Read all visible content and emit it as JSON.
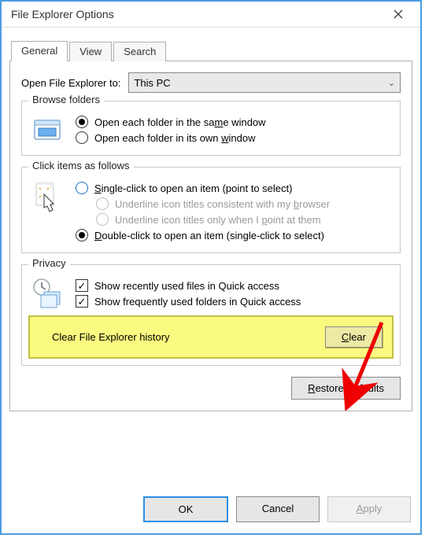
{
  "window": {
    "title": "File Explorer Options"
  },
  "tabs": {
    "general": "General",
    "view": "View",
    "search": "Search"
  },
  "open_to": {
    "label": "Open File Explorer to:",
    "value": "This PC"
  },
  "browse": {
    "legend": "Browse folders",
    "same_pre": "Open each folder in the sa",
    "same_u": "m",
    "same_post": "e window",
    "own_pre": "Open each folder in its own ",
    "own_u": "w",
    "own_post": "indow"
  },
  "click": {
    "legend": "Click items as follows",
    "single_u": "S",
    "single_post": "ingle-click to open an item (point to select)",
    "consistent_pre": "Underline icon titles consistent with my ",
    "consistent_u": "b",
    "consistent_post": "rowser",
    "point_pre": "Underline icon titles only when I ",
    "point_u": "p",
    "point_post": "oint at them",
    "double_u": "D",
    "double_post": "ouble-click to open an item (single-click to select)"
  },
  "privacy": {
    "legend": "Privacy",
    "recent": "Show recently used files in Quick access",
    "frequent": "Show frequently used folders in Quick access",
    "clear_label": "Clear File Explorer history",
    "clear_u": "C",
    "clear_post": "lear"
  },
  "restore": {
    "u": "R",
    "post": "estore Defaults"
  },
  "footer": {
    "ok": "OK",
    "cancel": "Cancel",
    "apply_u": "A",
    "apply_post": "pply"
  }
}
